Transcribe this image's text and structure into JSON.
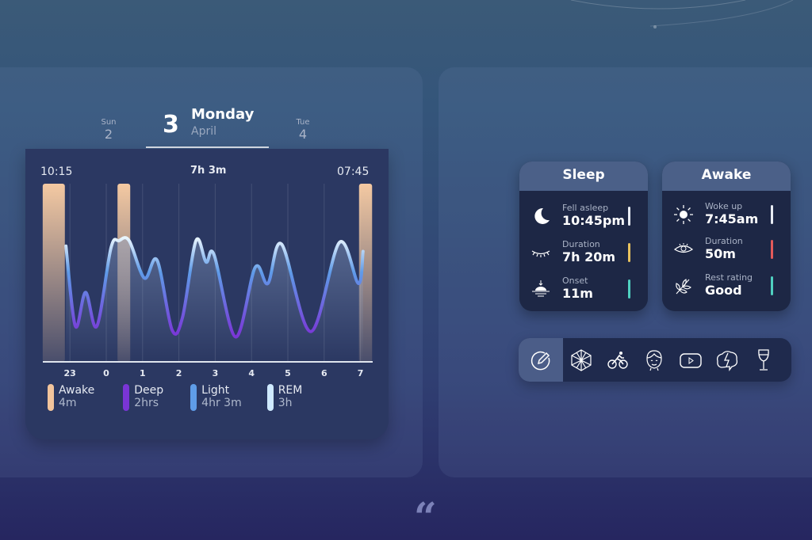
{
  "date_nav": {
    "prev": {
      "day_name": "Sun",
      "day_num": "2"
    },
    "current": {
      "day_num": "3",
      "day_name": "Monday",
      "month": "April"
    },
    "next": {
      "day_name": "Tue",
      "day_num": "4"
    }
  },
  "chart_data": {
    "type": "line",
    "start_label": "10:15",
    "total_label": "7h 3m",
    "end_label": "07:45",
    "x_ticks": [
      "23",
      "0",
      "1",
      "2",
      "3",
      "4",
      "5",
      "6",
      "7"
    ],
    "x_tick_hours": [
      -1,
      0,
      1,
      2,
      3,
      4,
      5,
      6,
      7
    ],
    "y_meaning": "sleep depth, 0 = awake, 1 = deep",
    "curve": [
      [
        -1.11,
        0.35
      ],
      [
        -0.85,
        0.8
      ],
      [
        -0.57,
        0.61
      ],
      [
        -0.26,
        0.8
      ],
      [
        0.13,
        0.36
      ],
      [
        0.35,
        0.32
      ],
      [
        0.63,
        0.32
      ],
      [
        1.05,
        0.53
      ],
      [
        1.4,
        0.43
      ],
      [
        1.81,
        0.82
      ],
      [
        2.1,
        0.75
      ],
      [
        2.47,
        0.32
      ],
      [
        2.75,
        0.44
      ],
      [
        2.97,
        0.4
      ],
      [
        3.56,
        0.86
      ],
      [
        4.1,
        0.47
      ],
      [
        4.45,
        0.56
      ],
      [
        4.83,
        0.34
      ],
      [
        5.63,
        0.83
      ],
      [
        6.42,
        0.33
      ],
      [
        6.94,
        0.56
      ],
      [
        7.07,
        0.38
      ]
    ],
    "awake_periods": [
      [
        -1.75,
        -1.14
      ],
      [
        0.31,
        0.66
      ],
      [
        6.96,
        7.32
      ]
    ],
    "legend": [
      {
        "name": "Awake",
        "value": "4m",
        "color": "#f2c49c"
      },
      {
        "name": "Deep",
        "value": "2hrs",
        "color": "#7a35d6"
      },
      {
        "name": "Light",
        "value": "4hr 3m",
        "color": "#5f9de8"
      },
      {
        "name": "REM",
        "value": "3h",
        "color": "#cfeaff"
      }
    ]
  },
  "sleep_card": {
    "title": "Sleep",
    "rows": [
      {
        "label": "Fell asleep",
        "value": "10:45pm",
        "icon": "moon-icon",
        "color": "#e8ecf4"
      },
      {
        "label": "Duration",
        "value": "7h 20m",
        "icon": "closed-eye-icon",
        "color": "#e8c25e"
      },
      {
        "label": "Onset",
        "value": "11m",
        "icon": "sunset-icon",
        "color": "#4fd0c0"
      }
    ]
  },
  "awake_card": {
    "title": "Awake",
    "rows": [
      {
        "label": "Woke up",
        "value": "7:45am",
        "icon": "sun-icon",
        "color": "#e8ecf4"
      },
      {
        "label": "Duration",
        "value": "50m",
        "icon": "eye-icon",
        "color": "#e25a5a"
      },
      {
        "label": "Rest rating",
        "value": "Good",
        "icon": "leaf-icon",
        "color": "#4fd0c0"
      }
    ]
  },
  "toolbar": [
    "edit-icon",
    "polyhedron-icon",
    "cyclist-icon",
    "face-icon",
    "video-icon",
    "brain-icon",
    "wine-glass-icon"
  ],
  "quote_mark": "“"
}
